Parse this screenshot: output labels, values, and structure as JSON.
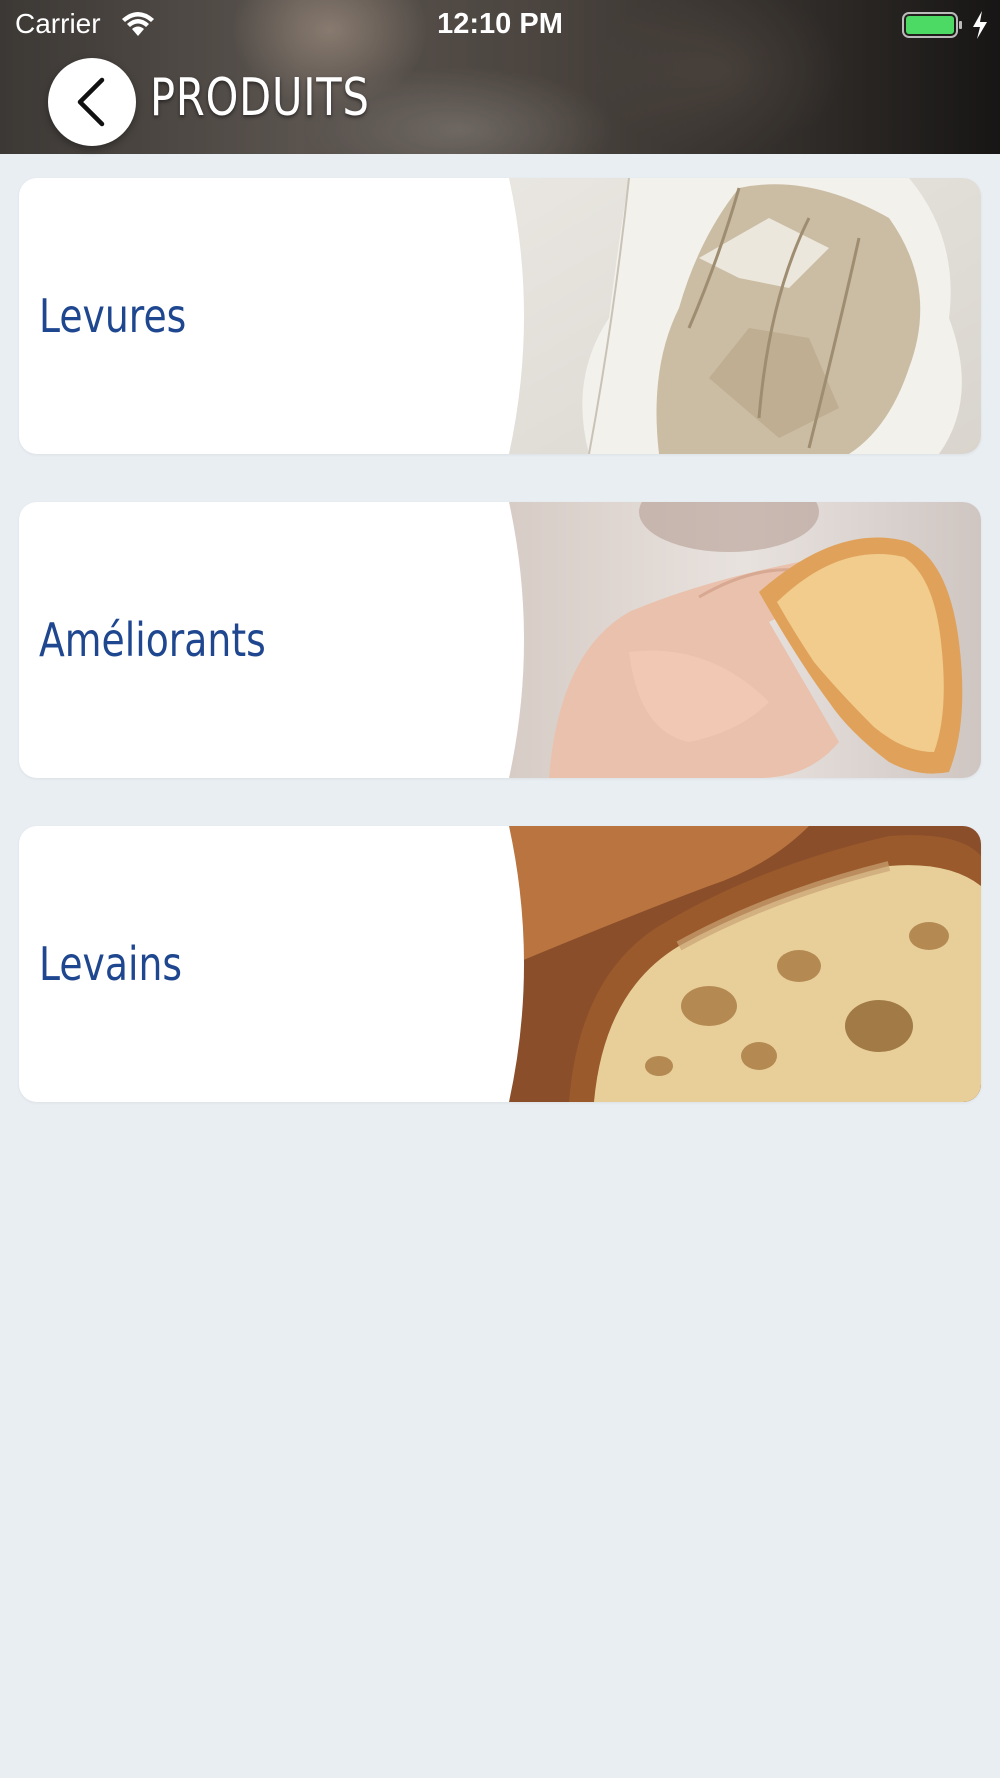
{
  "status_bar": {
    "carrier": "Carrier",
    "time": "12:10 PM"
  },
  "header": {
    "title": "PRODUITS",
    "back_icon": "chevron-left-icon"
  },
  "products": [
    {
      "label": "Levures",
      "image": "yeast-block-photo"
    },
    {
      "label": "Améliorants",
      "image": "hand-squeezing-bread-photo"
    },
    {
      "label": "Levains",
      "image": "sourdough-crumb-photo"
    }
  ],
  "colors": {
    "background": "#e9eef3",
    "card": "#ffffff",
    "label": "#1f4790",
    "battery": "#4cd964"
  }
}
